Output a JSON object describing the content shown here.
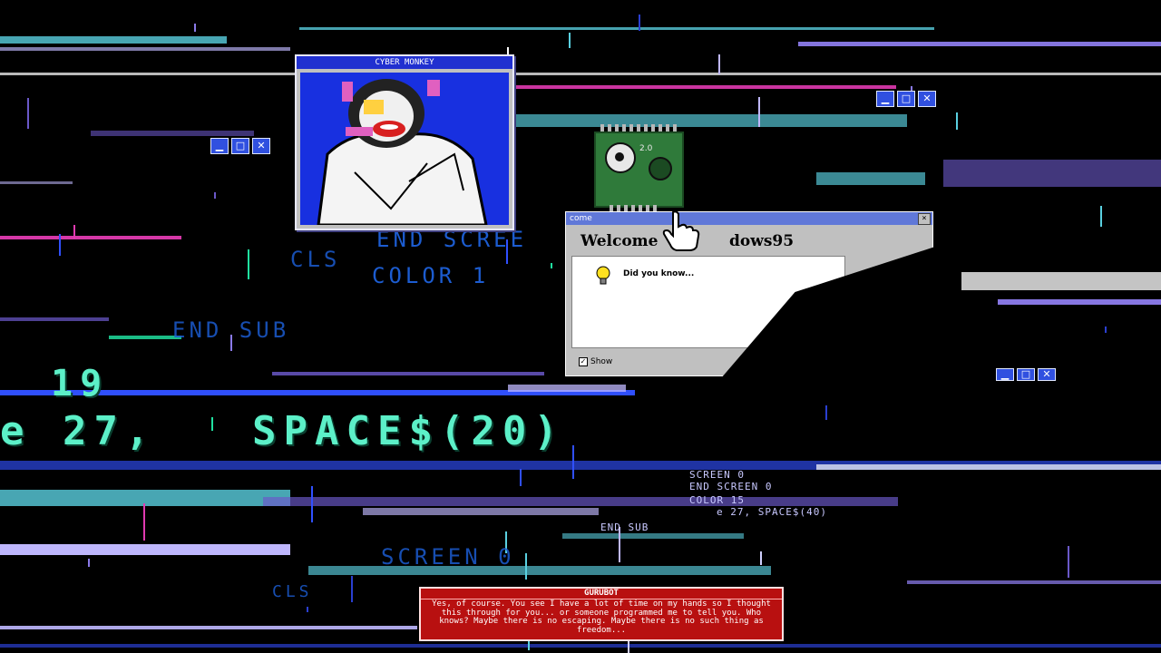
{
  "monkey_window": {
    "title": "CYBER MONKEY"
  },
  "welcome_dialog": {
    "title_fragment": "come",
    "heading_left": "Welcome",
    "heading_right": "dows95",
    "tip_label": "Did you know...",
    "checkbox_label": "Show",
    "close_glyph": "×"
  },
  "chip": {
    "version": "2.0"
  },
  "code_text": {
    "big_line_left": "e 27,",
    "big_line_right": "SPACE$(20)",
    "big_number": "19",
    "line_mid_1": "END SCREE",
    "line_mid_2": "CLS",
    "line_mid_3": "COLOR 1",
    "line_mid_4": "END SUB",
    "line_mid_5": "SCREEN 0",
    "line_mid_6": "CLS",
    "line_small_1": "SCREEN 0",
    "line_small_2": "END SCREEN 0",
    "line_small_3": "e 27, SPACE$(40)",
    "line_small_4": "END SUB",
    "line_small_5": "COLOR 15",
    "line_small_6": "∅SCREEN 0",
    "line_small_7": "e 27, SPACE$(20)"
  },
  "gurubot": {
    "name": "GURUBOT",
    "message": "Yes, of course. You see I have a lot of time on my hands so I thought this through for you... or someone programmed me to tell you. Who knows? Maybe there is no escaping. Maybe there is no such thing as freedom..."
  },
  "colors": {
    "background": "#000000",
    "code_green": "#5cf0c8",
    "code_blue": "#1c5cd0",
    "glitch_purple": "#8a7ae8",
    "glitch_pink": "#e03ab0",
    "gurubot_red": "#b81010",
    "window_blue": "#2030d0"
  }
}
